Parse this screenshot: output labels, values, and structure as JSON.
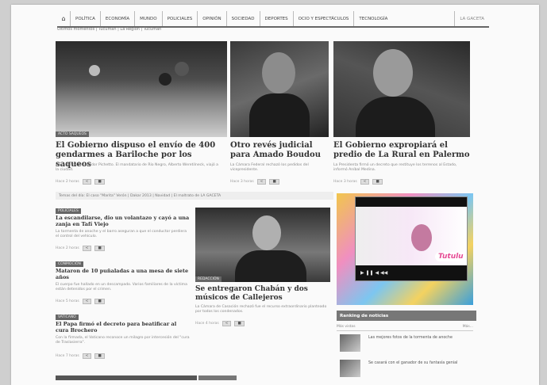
{
  "nav": {
    "home_icon": "home-icon",
    "items": [
      "POLÍTICA",
      "ECONOMÍA",
      "MUNDO",
      "POLICIALES",
      "OPINIÓN",
      "SOCIEDAD",
      "DEPORTES",
      "OCIO Y ESPECTÁCULOS",
      "TECNOLOGÍA"
    ],
    "last": "LA GACETA"
  },
  "subnav": "Últimos momentos | Tucumán | La Región | Tucumán",
  "stories": {
    "s1": {
      "tag": "ACTO SAQUEOS",
      "headline": "El Gobierno dispuso el envío de 400 gendarmes a Bariloche por los saqueos",
      "deck": "Lo confirmó el senador Pichetto. El mandatario de Río Negro, Alberto Weretilneck, viajó a la ciudad.",
      "meta": "Hace 2 horas"
    },
    "s2": {
      "headline": "Otro revés judicial para Amado Boudou",
      "deck": "La Cámara Federal rechazó los pedidos del vicepresidente.",
      "meta": "Hace 3 horas"
    },
    "s3": {
      "headline": "El Gobierno expropiará el predio de La Rural en Palermo",
      "deck": "La Presidenta firmó un decreto que restituye los terrenos al Estado, informó Aníbal Medina.",
      "meta": "Hace 3 horas"
    },
    "s4": {
      "tag": "POLICIALES",
      "headline": "La escandilarse, dio un volantazo y cayó a una zanja en Tafí Viejo",
      "deck": "La tormenta de anoche y el barro aseguran a que el conductor perdiera el control del vehículo.",
      "meta": "Hace 2 horas"
    },
    "s5": {
      "tag": "CONMOCIÓN",
      "headline": "Mataron de 10 puñaladas a una mesa de siete años",
      "deck": "El cuerpo fue hallado en un descampado. Varios familiares de la víctima están detenidos por el crimen.",
      "meta": "Hace 5 horas"
    },
    "s6": {
      "tag": "VATICANO",
      "headline": "El Papa firmó el decreto para beatificar al cura Brochero",
      "deck": "Con la firmada, el Vaticano reconoce un milagro por intercesión del \"cura de Traslasierra\".",
      "meta": "Hace 7 horas"
    },
    "s7": {
      "tag": "REDACCIÓN",
      "headline": "Se entregaron Chabán y dos músicos de Callejeros",
      "deck": "La Cámara de Casación rechazó fue el recurso extraordinario planteado por todos los condenados.",
      "meta": "Hace 4 horas"
    }
  },
  "strip": "Temas del día: El caso \"Marita\" Verón | Dakar 2013 | Navidad | El maltrato de LA GACETA",
  "buttons": {
    "share": "<",
    "comment": "■"
  },
  "ad": {
    "brand": "Tulio Triviño",
    "logo": "Tutulu"
  },
  "ranking": {
    "title": "Ranking de noticias",
    "tab_left": "Más vistas",
    "tab_right": "Más...",
    "items": [
      "Las mejores fotos de la tormenta de anoche",
      "Se casará con el ganador de su fantasía genial"
    ]
  },
  "player_controls": "▶ ❚❚ ◀ ◀◀"
}
